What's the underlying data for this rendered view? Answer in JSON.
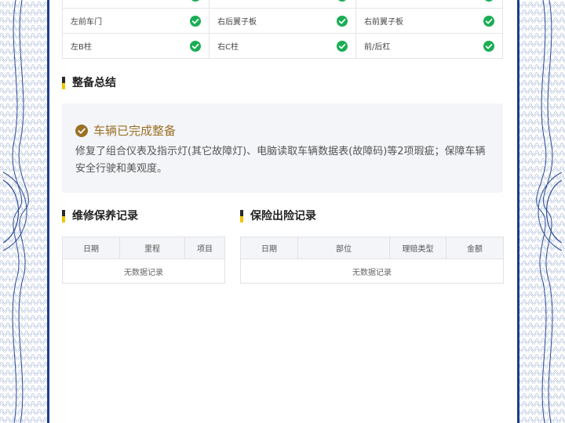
{
  "inspection_rows": [
    [
      {
        "label": "",
        "status": "ok"
      },
      {
        "label": "",
        "status": "ok"
      },
      {
        "label": "",
        "status": "ok"
      }
    ],
    [
      {
        "label": "左前车门",
        "status": "ok"
      },
      {
        "label": "右后翼子板",
        "status": "ok"
      },
      {
        "label": "右前翼子板",
        "status": "ok"
      }
    ],
    [
      {
        "label": "左B柱",
        "status": "ok"
      },
      {
        "label": "右C柱",
        "status": "ok"
      },
      {
        "label": "前/后杠",
        "status": "ok"
      }
    ]
  ],
  "summary": {
    "title": "整备总结",
    "status_text": "车辆已完成整备",
    "description": "修复了组合仪表及指示灯(其它故障灯)、电脑读取车辆数据表(故障码)等2项瑕疵；保障车辆安全行驶和美观度。"
  },
  "maintenance": {
    "title": "维修保养记录",
    "columns": [
      "日期",
      "里程",
      "项目"
    ],
    "empty_text": "无数据记录"
  },
  "insurance": {
    "title": "保险出险记录",
    "columns": [
      "日期",
      "部位",
      "理赔类型",
      "金额"
    ],
    "empty_text": "无数据记录"
  },
  "colors": {
    "frame": "#1f3f86",
    "check_green": "#1aad55",
    "gold": "#9b7126",
    "accent_yellow": "#f2c200"
  },
  "icons": {
    "status_ok": "check-circle-icon",
    "summary_done": "check-circle-icon"
  }
}
